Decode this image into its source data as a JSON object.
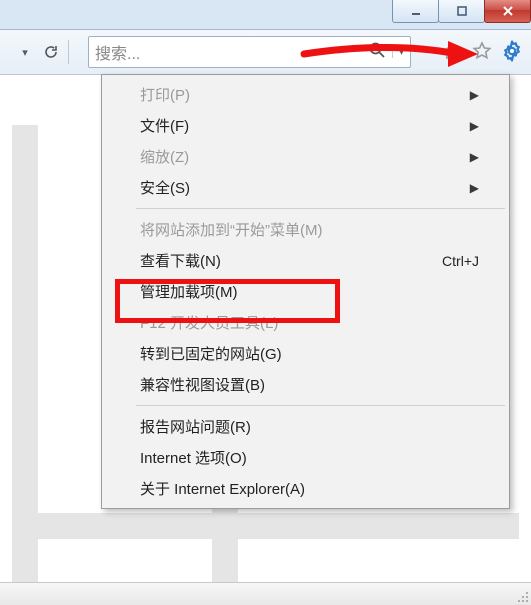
{
  "search": {
    "placeholder": "搜索..."
  },
  "menu": {
    "items": [
      {
        "label": "打印(P)",
        "disabled": true,
        "submenu": true
      },
      {
        "label": "文件(F)",
        "submenu": true
      },
      {
        "label": "缩放(Z)",
        "disabled": true,
        "submenu": true
      },
      {
        "label": "安全(S)",
        "submenu": true
      }
    ],
    "items2": [
      {
        "label": "将网站添加到“开始”菜单(M)",
        "disabled": true
      },
      {
        "label": "查看下载(N)",
        "shortcut": "Ctrl+J"
      },
      {
        "label": "管理加载项(M)"
      },
      {
        "label": "F12 开发人员工具(L)",
        "disabled": true
      },
      {
        "label": "转到已固定的网站(G)"
      },
      {
        "label": "兼容性视图设置(B)"
      }
    ],
    "items3": [
      {
        "label": "报告网站问题(R)"
      },
      {
        "label": "Internet 选项(O)"
      },
      {
        "label": "关于 Internet Explorer(A)"
      }
    ]
  }
}
